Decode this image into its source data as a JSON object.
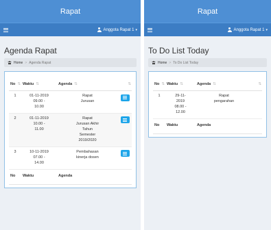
{
  "left": {
    "app_title": "Rapat",
    "user_label": "Anggota Rapat 1",
    "page_title": "Agenda Rapat",
    "breadcrumb": {
      "home": "Home",
      "separator": ">",
      "current": "Agenda Rapat"
    },
    "table": {
      "headers": {
        "no": "No",
        "waktu": "Waktu",
        "agenda": "Agenda"
      },
      "rows": [
        {
          "no": "1",
          "waktu": [
            "01-11-2019",
            "09.00 -",
            "10.00"
          ],
          "agenda": [
            "Rapat",
            "Jurusan"
          ]
        },
        {
          "no": "2",
          "waktu": [
            "01-11-2019",
            "10.00 -",
            "11.00"
          ],
          "agenda": [
            "Rapat",
            "Jurusan Akhir",
            "Tahun",
            "Semester",
            "2019/2020"
          ]
        },
        {
          "no": "3",
          "waktu": [
            "10-11-2019",
            "07.00 -",
            "14.00"
          ],
          "agenda": [
            "Pembahasan",
            "kinerja dosen"
          ]
        }
      ],
      "footer": {
        "no": "No",
        "waktu": "Waktu",
        "agenda": "Agenda"
      }
    }
  },
  "right": {
    "app_title": "Rapat",
    "user_label": "Anggota Rapat 1",
    "page_title": "To Do List Today",
    "breadcrumb": {
      "home": "Home",
      "separator": ">",
      "current": "To Do List Today"
    },
    "table": {
      "headers": {
        "no": "No",
        "waktu": "Waktu",
        "agenda": "Agenda"
      },
      "rows": [
        {
          "no": "1",
          "waktu": [
            "29-11-",
            "2019",
            "08.00 -",
            "12.00"
          ],
          "agenda": [
            "Rapat",
            "pengarahan"
          ]
        }
      ],
      "footer": {
        "no": "No",
        "waktu": "Waktu",
        "agenda": "Agenda"
      }
    }
  },
  "icons": {
    "menu": "hamburger-icon",
    "user": "user-icon",
    "caret": "caret-down-icon",
    "home": "home-icon",
    "sort": "sort-icon",
    "detail": "list-icon"
  },
  "colors": {
    "titlebar": "#4e8fd4",
    "navbar": "#3c7dc4",
    "action_button": "#1ea5e9",
    "card_border": "#8fc0e6",
    "background": "#ecf0f5"
  }
}
